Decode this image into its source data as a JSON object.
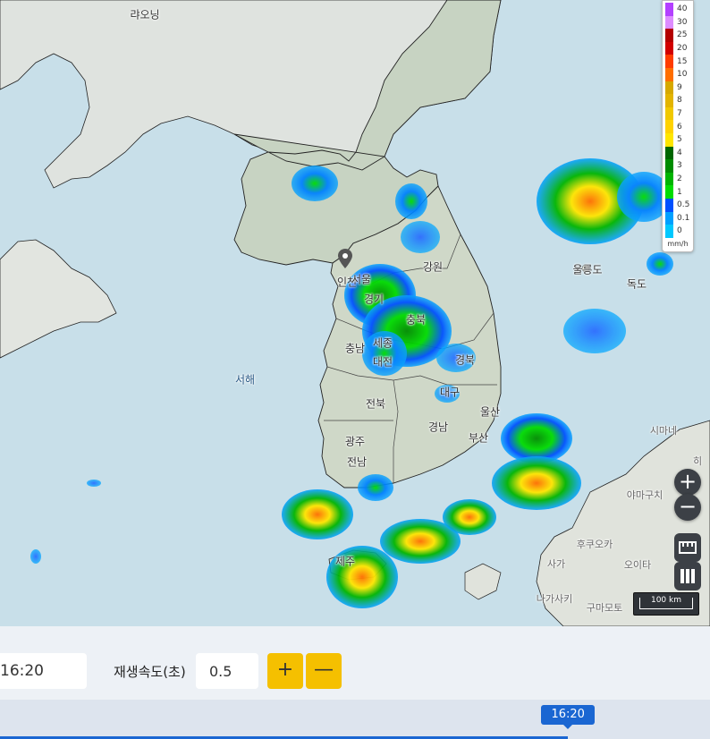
{
  "map": {
    "labels": {
      "laoning": "랴오닝",
      "gangwon": "강원",
      "incheon": "인천",
      "seoul": "서울",
      "gyeonggi": "경기",
      "chungbuk": "충북",
      "chungnam": "충남",
      "sejong": "세종",
      "daejeon": "대전",
      "gyeongbuk": "경북",
      "daegu": "대구",
      "jeonbuk": "전북",
      "gyeongnam": "경남",
      "ulsan": "울산",
      "busan": "부산",
      "gwangju": "광주",
      "jeonnam": "전남",
      "jeju": "제주",
      "west_sea": "서해",
      "ulleungdo": "울릉도",
      "dokdo": "독도",
      "shimane": "시마네",
      "yamaguchi": "야마구치",
      "fukuoka": "후쿠오카",
      "oita": "오이타",
      "saga": "사가",
      "nagasaki": "나가사키",
      "kumamoto": "구마모토",
      "hiroshima_partial": "히"
    },
    "marker": "location-pin-icon"
  },
  "legend": {
    "unit": "mm/h",
    "entries": [
      {
        "label": "40",
        "color": "#b340ff"
      },
      {
        "label": "30",
        "color": "#dd8cff"
      },
      {
        "label": "25",
        "color": "#b40000"
      },
      {
        "label": "20",
        "color": "#d20000"
      },
      {
        "label": "15",
        "color": "#ff3c00"
      },
      {
        "label": "10",
        "color": "#ff6e00"
      },
      {
        "label": "9",
        "color": "#d6a800"
      },
      {
        "label": "8",
        "color": "#e3b400"
      },
      {
        "label": "7",
        "color": "#f0c800"
      },
      {
        "label": "6",
        "color": "#ffd200"
      },
      {
        "label": "5",
        "color": "#ffe600"
      },
      {
        "label": "4",
        "color": "#006600"
      },
      {
        "label": "3",
        "color": "#008c00"
      },
      {
        "label": "2",
        "color": "#00b400"
      },
      {
        "label": "1",
        "color": "#00dc00"
      },
      {
        "label": "0.5",
        "color": "#0050ff"
      },
      {
        "label": "0.1",
        "color": "#00a0ff"
      },
      {
        "label": "0",
        "color": "#00c8ff"
      }
    ]
  },
  "map_controls": {
    "zoom_in": "+",
    "zoom_out": "−",
    "scale_label": "100 km"
  },
  "controls": {
    "time_value": "16:20",
    "speed_label": "재생속도(초)",
    "speed_value": "0.5",
    "plus_label": "+",
    "minus_label": "—"
  },
  "timeline": {
    "current_time": "16:20",
    "progress": 0.8
  }
}
